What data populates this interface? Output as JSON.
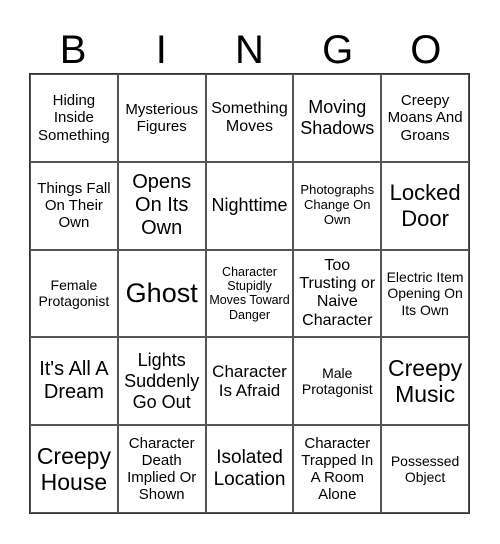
{
  "header": [
    "B",
    "I",
    "N",
    "G",
    "O"
  ],
  "cells": [
    "Hiding Inside Something",
    "Mysterious Figures",
    "Something Moves",
    "Moving Shadows",
    "Creepy Moans And Groans",
    "Things Fall On Their Own",
    "Opens On Its Own",
    "Nighttime",
    "Photographs Change On Own",
    "Locked Door",
    "Female Protagonist",
    "Ghost",
    "Character Stupidly Moves Toward Danger",
    "Too Trusting or Naive Character",
    "Electric Item Opening On Its Own",
    "It's All A Dream",
    "Lights Suddenly Go Out",
    "Character Is Afraid",
    "Male Protagonist",
    "Creepy Music",
    "Creepy House",
    "Character Death Implied Or Shown",
    "Isolated Location",
    "Character Trapped In A Room Alone",
    "Possessed Object"
  ]
}
